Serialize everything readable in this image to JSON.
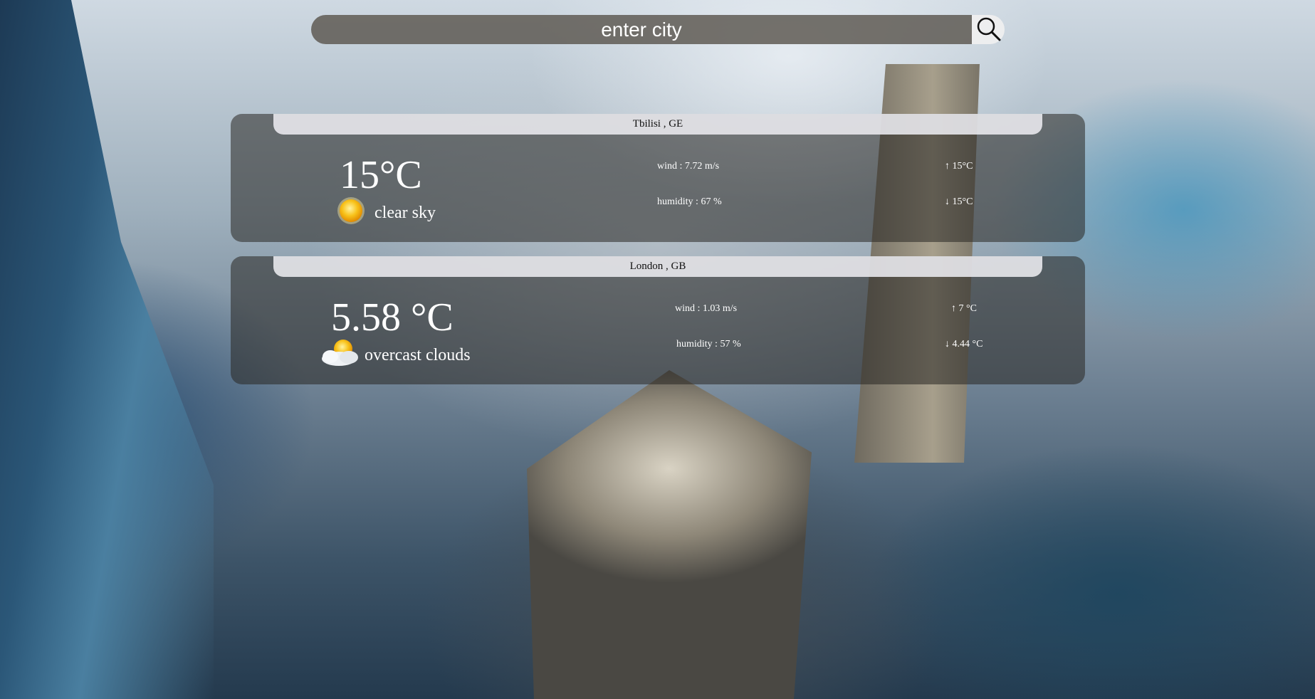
{
  "search": {
    "placeholder": "enter city",
    "icon": "search-icon"
  },
  "cards": [
    {
      "location": "Tbilisi , GE",
      "temperature": "15°C",
      "description": "clear sky",
      "icon": "sun-icon",
      "wind": "wind : 7.72 m/s",
      "humidity": "humidity : 67 %",
      "temp_max": "↑ 15°C",
      "temp_min": "↓ 15°C"
    },
    {
      "location": "London , GB",
      "temperature": "5.58 °C",
      "description": "overcast clouds",
      "icon": "cloud-sun-icon",
      "wind": "wind : 1.03 m/s",
      "humidity": "humidity : 57 %",
      "temp_max": "↑ 7 °C",
      "temp_min": "↓ 4.44 °C"
    }
  ],
  "colors": {
    "card_bg": "#28262399",
    "header_bg": "#e8e8ec",
    "search_bg": "#5a554e",
    "sun": "#f5b400"
  }
}
